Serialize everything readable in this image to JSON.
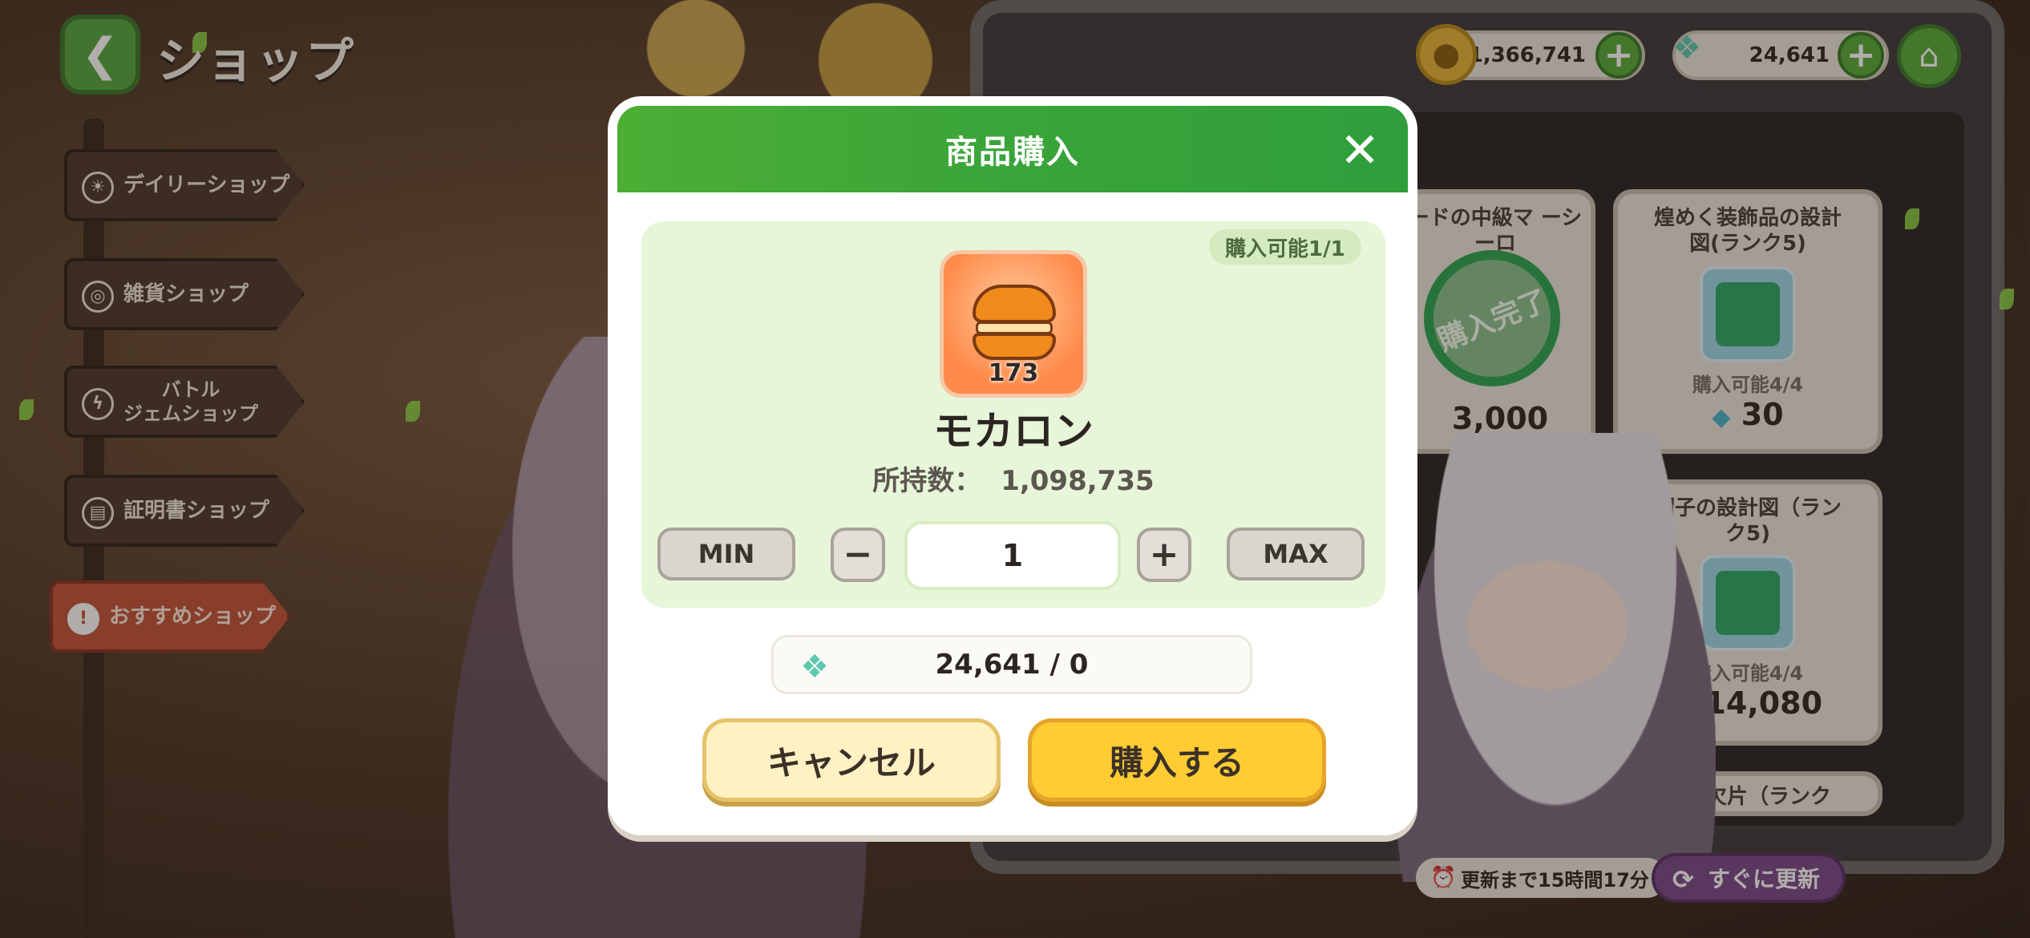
{
  "header": {
    "title": "ショップ",
    "back_icon": "chevron-left-icon",
    "home_icon": "home-icon"
  },
  "currencies": [
    {
      "name": "gold",
      "icon": "coin-icon",
      "value": "1,366,741"
    },
    {
      "name": "gem",
      "icon": "crystal-icon",
      "value": "24,641"
    }
  ],
  "sidebar": {
    "items": [
      {
        "label": "デイリーショップ",
        "icon": "sun-icon",
        "active": false
      },
      {
        "label": "雑貨ショップ",
        "icon": "items-icon",
        "active": false
      },
      {
        "label": "バトル\nジェムショップ",
        "icon": "lightning-icon",
        "active": false
      },
      {
        "label": "証明書ショップ",
        "icon": "certificate-icon",
        "active": false
      },
      {
        "label": "おすすめショップ",
        "icon": "exclamation-icon",
        "active": true
      }
    ]
  },
  "shop_cards": [
    {
      "title": "ードの中級マ\nーシーロ",
      "price": "3,000",
      "stamp": "購入完了"
    },
    {
      "title": "煌めく装飾品の設計\n図(ランク5)",
      "limit": "購入可能4/4",
      "price": "30"
    },
    {
      "title": "帽子の設計図（ラン\nク5)",
      "limit": "購入可能4/4",
      "price": "14,080"
    },
    {
      "title": "鐙の欠片（ランク",
      "price": ""
    }
  ],
  "refresh": {
    "timer_label": "更新まで15時間17分",
    "now_label": "すぐに更新"
  },
  "modal": {
    "title": "商品購入",
    "limit_badge": "購入可能1/1",
    "item_name": "モカロン",
    "item_count": "173",
    "owned_label": "所持数：",
    "owned_value": "1,098,735",
    "min_label": "MIN",
    "max_label": "MAX",
    "minus_label": "−",
    "plus_label": "+",
    "quantity": "1",
    "cost": "24,641 / 0",
    "cancel_label": "キャンセル",
    "buy_label": "購入する"
  },
  "colors": {
    "header_green": "#3aa43a",
    "panel_green": "#e7f5d8",
    "buy_yellow": "#ffcc33",
    "cancel_cream": "#fff1c2",
    "active_tab": "#c2553b"
  }
}
